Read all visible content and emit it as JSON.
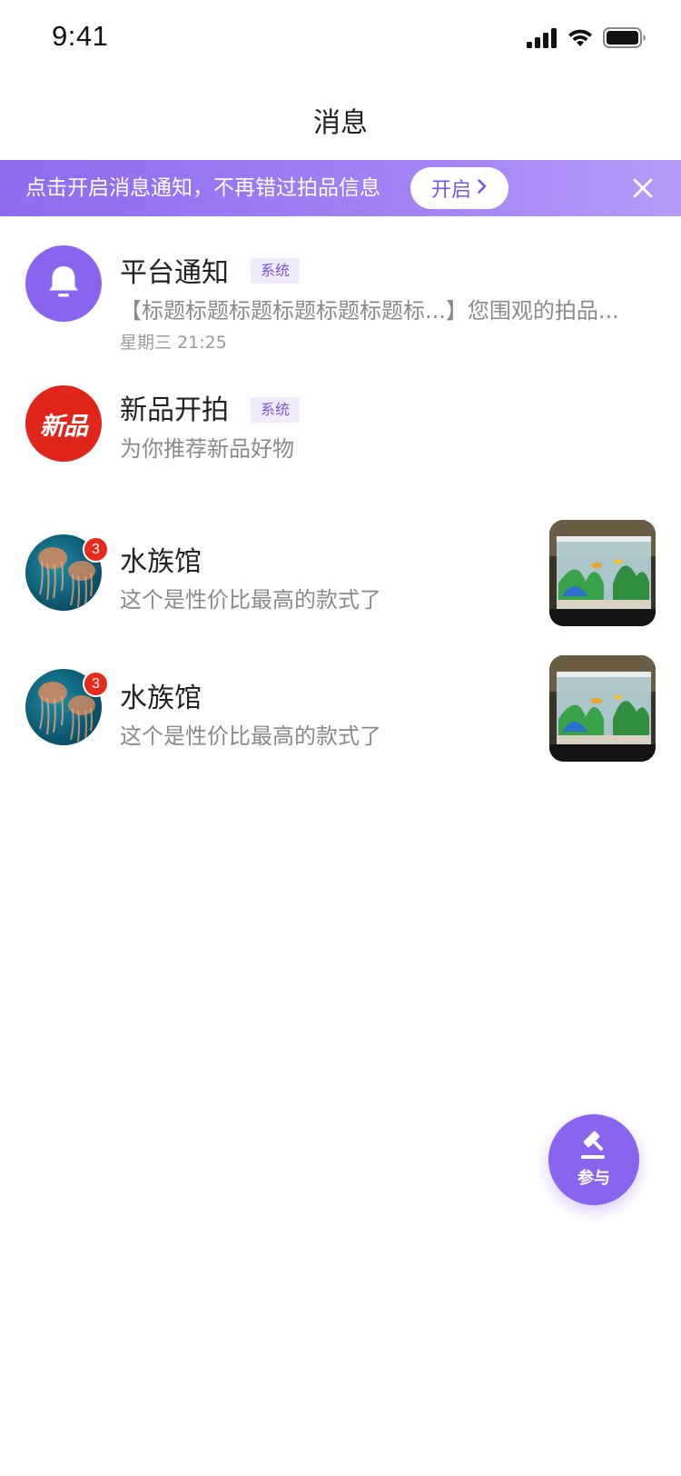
{
  "status_bar": {
    "time": "9:41",
    "icons": [
      "signal-icon",
      "wifi-icon",
      "battery-icon"
    ]
  },
  "navbar": {
    "title": "消息"
  },
  "banner": {
    "text": "点击开启消息通知，不再错过拍品信息",
    "button_label": "开启",
    "close_icon": "close-icon"
  },
  "messages": [
    {
      "title": "平台通知",
      "tag": "系统",
      "subtitle": "【标题标题标题标题标题标题标...】您围观的拍品...",
      "time": "星期三 21:25",
      "avatar_icon": "bell-icon"
    },
    {
      "title": "新品开拍",
      "tag": "系统",
      "subtitle": "为你推荐新品好物",
      "avatar_text": "新品"
    },
    {
      "title": "水族馆",
      "subtitle": "这个是性价比最高的款式了",
      "badge": "3",
      "thumbnail": "aquarium-image"
    },
    {
      "title": "水族馆",
      "subtitle": "这个是性价比最高的款式了",
      "badge": "3",
      "thumbnail": "aquarium-image"
    }
  ],
  "fab": {
    "label": "参与",
    "icon": "gavel-icon"
  },
  "colors": {
    "primary": "#8a63ee",
    "banner_start": "#8f6af0",
    "banner_end": "#b69bf7",
    "badge_red": "#e72a1c",
    "new_red": "#e0261a"
  }
}
